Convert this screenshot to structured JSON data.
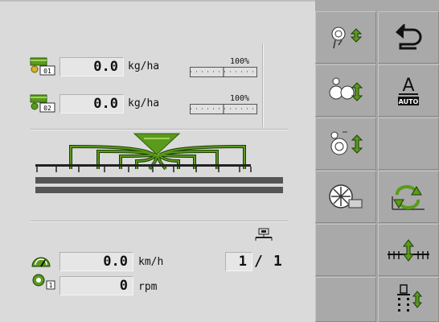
{
  "rates": [
    {
      "value": "0.0",
      "unit": "kg/ha",
      "percent": "100%",
      "tank": "01",
      "level": 0.0
    },
    {
      "value": "0.0",
      "unit": "kg/ha",
      "percent": "100%",
      "tank": "02",
      "level": 0.0
    }
  ],
  "speed": {
    "value": "0.0",
    "unit": "km/h"
  },
  "fan": {
    "value": "0",
    "unit": "rpm",
    "tag": "1"
  },
  "section_counter": {
    "current": "1",
    "separator": "/",
    "total": "1"
  },
  "colors": {
    "accent_green": "#5a9a1c",
    "dark_green": "#2e5c0a",
    "panel": "#dadada",
    "softkey": "#a9a9a9"
  },
  "softkeys": [
    {
      "name": "metering-unit-select-button",
      "icon": "metering-icon"
    },
    {
      "name": "back-button",
      "icon": "return-arrow-icon"
    },
    {
      "name": "calibration-button",
      "icon": "calibration-icon"
    },
    {
      "name": "auto-mode-button",
      "icon": "auto-a-icon",
      "label_top": "A",
      "label_bottom": "AUTO"
    },
    {
      "name": "metering-unit-2-button",
      "icon": "metering-unit-icon"
    },
    {
      "name": "empty-softkey",
      "icon": ""
    },
    {
      "name": "fan-settings-button",
      "icon": "fan-icon"
    },
    {
      "name": "ramp-rotate-button",
      "icon": "rotate-icon"
    },
    {
      "name": "empty-softkey",
      "icon": ""
    },
    {
      "name": "implement-lift-button",
      "icon": "implement-lift-icon"
    },
    {
      "name": "empty-softkey",
      "icon": ""
    },
    {
      "name": "tramline-button",
      "icon": "tramline-icon"
    }
  ]
}
